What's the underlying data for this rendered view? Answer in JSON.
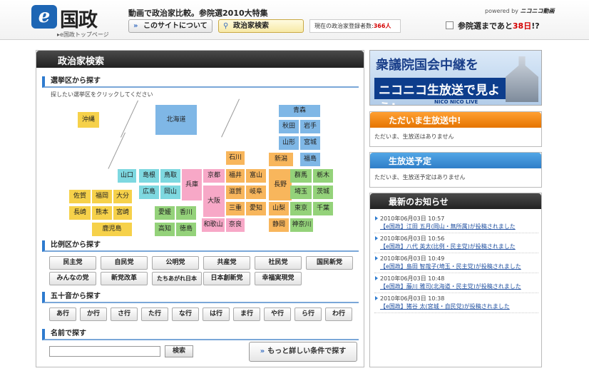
{
  "header": {
    "logo_mark": "e",
    "logo_kanji": "国政",
    "top_link": "e国政トップページ",
    "tagline": "動画で政治家比較。参院選2010大特集",
    "about_btn": "このサイトについて",
    "search_btn": "政治家検索",
    "count_label": "現在の政治家登録者数:",
    "count_value": "366人",
    "powered_label": "powered by",
    "powered_brand": "ニコニコ動画",
    "election_prefix": "参院選まであと",
    "election_days": "38日",
    "election_suffix": "!?"
  },
  "main": {
    "title": "政治家検索",
    "district": {
      "heading": "選挙区から探す",
      "note": "探したい選挙区をクリックしてください",
      "prefectures": [
        "沖縄",
        "北海道",
        "青森",
        "秋田",
        "岩手",
        "山形",
        "宮城",
        "新潟",
        "福島",
        "石川",
        "山口",
        "島根",
        "鳥取",
        "京都",
        "福井",
        "富山",
        "長野",
        "群馬",
        "栃木",
        "広島",
        "岡山",
        "兵庫",
        "大阪",
        "滋賀",
        "岐阜",
        "埼玉",
        "茨城",
        "佐賀",
        "福岡",
        "大分",
        "三重",
        "愛知",
        "山梨",
        "東京",
        "千葉",
        "長崎",
        "熊本",
        "宮崎",
        "愛媛",
        "香川",
        "和歌山",
        "奈良",
        "静岡",
        "神奈川",
        "鹿児島",
        "高知",
        "徳島"
      ]
    },
    "proportional": {
      "heading": "比例区から探す",
      "parties": [
        "民主党",
        "自民党",
        "公明党",
        "共産党",
        "社民党",
        "国民新党",
        "みんなの党",
        "新党改革",
        "たちあがれ日本",
        "日本創新党",
        "幸福実現党"
      ]
    },
    "kana": {
      "heading": "五十音から探す",
      "rows": [
        "あ行",
        "か行",
        "さ行",
        "た行",
        "な行",
        "は行",
        "ま行",
        "や行",
        "ら行",
        "わ行"
      ]
    },
    "name": {
      "heading": "名前で探す",
      "search_btn": "検索",
      "more_btn": "もっと詳しい条件で探す"
    }
  },
  "side": {
    "banner_line1": "衆議院国会中継を",
    "banner_line2": "ニコニコ生放送で見よう!",
    "banner_sub": "NICO NICO LIVE",
    "live": {
      "title": "ただいま生放送中!",
      "text": "ただいま、生放送はありません"
    },
    "scheduled": {
      "title": "生放送予定",
      "text": "ただいま、生放送予定はありません"
    },
    "news": {
      "title": "最新のお知らせ",
      "items": [
        {
          "time": "2010年06月03日 10:57",
          "text": "【e国政】江田 五月(岡山・無所属)が投稿されました"
        },
        {
          "time": "2010年06月03日 10:56",
          "text": "【e国政】八代 英太(比例・民主党)が投稿されました"
        },
        {
          "time": "2010年06月03日 10:49",
          "text": "【e国政】島田 智哉子(埼玉・民主党)が投稿されました"
        },
        {
          "time": "2010年06月03日 10:48",
          "text": "【e国政】藤川 雅司(北海道・民主党)が投稿されました"
        },
        {
          "time": "2010年06月03日 10:38",
          "text": "【e国政】猪谷 太(宮城・自民党)が投稿されました"
        }
      ]
    }
  }
}
